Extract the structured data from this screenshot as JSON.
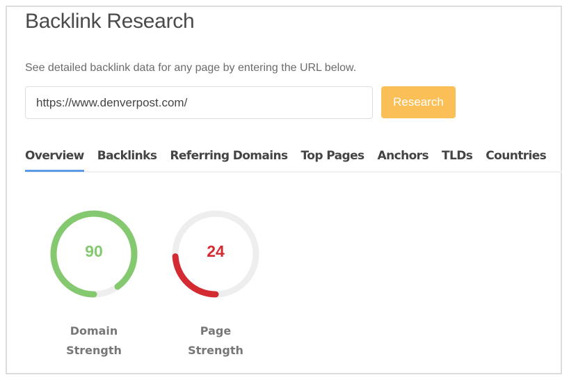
{
  "title": "Backlink Research",
  "description": "See detailed backlink data for any page by entering the URL below.",
  "url_input": {
    "value": "https://www.denverpost.com/"
  },
  "research_button": "Research",
  "tabs": [
    {
      "label": "Overview",
      "active": true
    },
    {
      "label": "Backlinks"
    },
    {
      "label": "Referring Domains"
    },
    {
      "label": "Top Pages"
    },
    {
      "label": "Anchors"
    },
    {
      "label": "TLDs"
    },
    {
      "label": "Countries"
    }
  ],
  "gauges": [
    {
      "value": 90,
      "max": 100,
      "label_line1": "Domain",
      "label_line2": "Strength",
      "color": "#84c96f"
    },
    {
      "value": 24,
      "max": 100,
      "label_line1": "Page",
      "label_line2": "Strength",
      "color": "#d42a31"
    }
  ],
  "colors": {
    "track": "#eeeeee",
    "accent": "#5b9be8",
    "button": "#fbbf57"
  }
}
